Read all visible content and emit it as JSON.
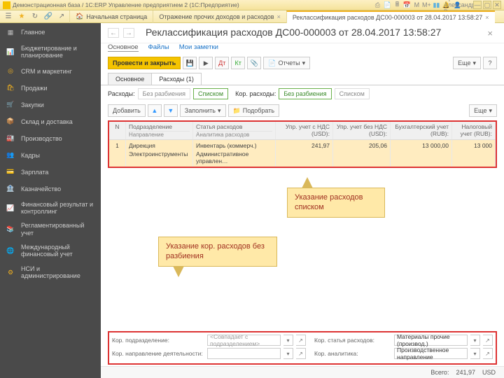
{
  "titlebar": {
    "title": "Демонстрационная база / 1С:ERP Управление предприятием 2  (1С:Предприятие)",
    "user": "Орлов Александр Владимирович"
  },
  "tabs": {
    "home": "Начальная страница",
    "t1": "Отражение прочих доходов и расходов",
    "t2": "Реклассификация расходов ДС00-000003 от 28.04.2017 13:58:27"
  },
  "sidebar": {
    "items": [
      {
        "label": "Главное"
      },
      {
        "label": "Бюджетирование и планирование"
      },
      {
        "label": "CRM и маркетинг"
      },
      {
        "label": "Продажи"
      },
      {
        "label": "Закупки"
      },
      {
        "label": "Склад и доставка"
      },
      {
        "label": "Производство"
      },
      {
        "label": "Кадры"
      },
      {
        "label": "Зарплата"
      },
      {
        "label": "Казначейство"
      },
      {
        "label": "Финансовый результат и контроллинг"
      },
      {
        "label": "Регламентированный учет"
      },
      {
        "label": "Международный финансовый учет"
      },
      {
        "label": "НСИ и администрирование"
      }
    ]
  },
  "doc": {
    "title": "Реклассификация расходов ДС00-000003 от 28.04.2017 13:58:27",
    "subtabs": {
      "main": "Основное",
      "files": "Файлы",
      "notes": "Мои заметки"
    },
    "cmd": {
      "post": "Провести и закрыть",
      "reports": "Отчеты",
      "more": "Еще"
    },
    "tabs2": {
      "main": "Основное",
      "exp": "Расходы (1)"
    },
    "filter": {
      "label": "Расходы:",
      "a": "Без разбиения",
      "b": "Списком",
      "label2": "Кор. расходы:",
      "c": "Без разбиения",
      "d": "Списком"
    },
    "tblcmd": {
      "add": "Добавить",
      "fill": "Заполнить",
      "pick": "Подобрать",
      "more": "Еще"
    },
    "cols": {
      "n": "N",
      "pod1": "Подразделение",
      "pod2": "Направление",
      "st1": "Статья расходов",
      "st2": "Аналитика расходов",
      "u1": "Упр. учет с НДС (USD):",
      "u2": "Упр. учет без НДС (USD):",
      "u3": "Бухгалтерский учет (RUB):",
      "u4": "Налоговый учет (RUB):"
    },
    "row": {
      "n": "1",
      "pod1": "Дирекция",
      "pod2": "Электроинструменты",
      "st1": "Инвентарь (коммерч.)",
      "st2": "Административное управлен…",
      "u1": "241,97",
      "u2": "205,06",
      "u3": "13 000,00",
      "u4": "13 000"
    },
    "callouts": {
      "c1": "Указание расходов списком",
      "c2": "Указание кор. расходов без разбиения"
    },
    "bottom": {
      "l1": "Кор. подразделение:",
      "p1": "<Совпадает с подразделением>",
      "l2": "Кор. статья расходов:",
      "v2": "Материалы прочие (производ.)",
      "l3": "Кор. направление деятельности:",
      "l4": "Кор. аналитика:",
      "v4": "Производственное направление"
    },
    "total": {
      "label": "Всего:",
      "sum": "241,97",
      "cur": "USD"
    }
  }
}
